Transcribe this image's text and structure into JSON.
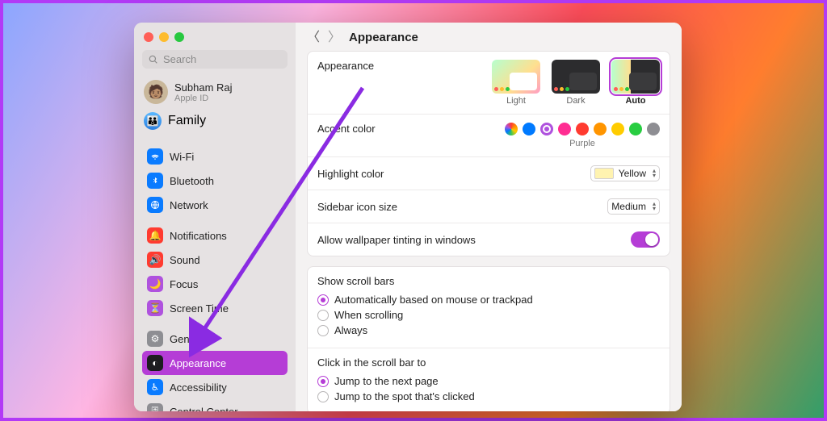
{
  "window_title": "Appearance",
  "search": {
    "placeholder": "Search"
  },
  "user": {
    "name": "Subham Raj",
    "sub": "Apple ID"
  },
  "family": {
    "label": "Family"
  },
  "sidebar": {
    "items": [
      {
        "id": "wifi",
        "label": "Wi-Fi"
      },
      {
        "id": "bluetooth",
        "label": "Bluetooth"
      },
      {
        "id": "network",
        "label": "Network"
      },
      {
        "id": "notifications",
        "label": "Notifications"
      },
      {
        "id": "sound",
        "label": "Sound"
      },
      {
        "id": "focus",
        "label": "Focus"
      },
      {
        "id": "screentime",
        "label": "Screen Time"
      },
      {
        "id": "general",
        "label": "General"
      },
      {
        "id": "appearance",
        "label": "Appearance"
      },
      {
        "id": "accessibility",
        "label": "Accessibility"
      },
      {
        "id": "controlcenter",
        "label": "Control Center"
      }
    ]
  },
  "appearance": {
    "section_label": "Appearance",
    "modes": [
      {
        "id": "light",
        "label": "Light"
      },
      {
        "id": "dark",
        "label": "Dark"
      },
      {
        "id": "auto",
        "label": "Auto"
      }
    ],
    "selected_mode": "auto"
  },
  "accent": {
    "section_label": "Accent color",
    "selected_name": "Purple",
    "colors": [
      {
        "id": "multicolor",
        "hex": "multicolor"
      },
      {
        "id": "blue",
        "hex": "#007aff"
      },
      {
        "id": "purple",
        "hex": "#af52de"
      },
      {
        "id": "pink",
        "hex": "#ff2d92"
      },
      {
        "id": "red",
        "hex": "#ff3b30"
      },
      {
        "id": "orange",
        "hex": "#ff9500"
      },
      {
        "id": "yellow",
        "hex": "#ffcc00"
      },
      {
        "id": "green",
        "hex": "#28cd41"
      },
      {
        "id": "graphite",
        "hex": "#8e8e93"
      }
    ],
    "selected_id": "purple"
  },
  "highlight": {
    "section_label": "Highlight color",
    "value_label": "Yellow",
    "swatch_hex": "#fff3b0"
  },
  "sidebar_icon": {
    "section_label": "Sidebar icon size",
    "value_label": "Medium"
  },
  "wallpaper_tint": {
    "section_label": "Allow wallpaper tinting in windows",
    "on": true
  },
  "scrollbars": {
    "section_label": "Show scroll bars",
    "options": [
      "Automatically based on mouse or trackpad",
      "When scrolling",
      "Always"
    ],
    "selected_index": 0
  },
  "click_scrollbar": {
    "section_label": "Click in the scroll bar to",
    "options": [
      "Jump to the next page",
      "Jump to the spot that's clicked"
    ],
    "selected_index": 0
  }
}
